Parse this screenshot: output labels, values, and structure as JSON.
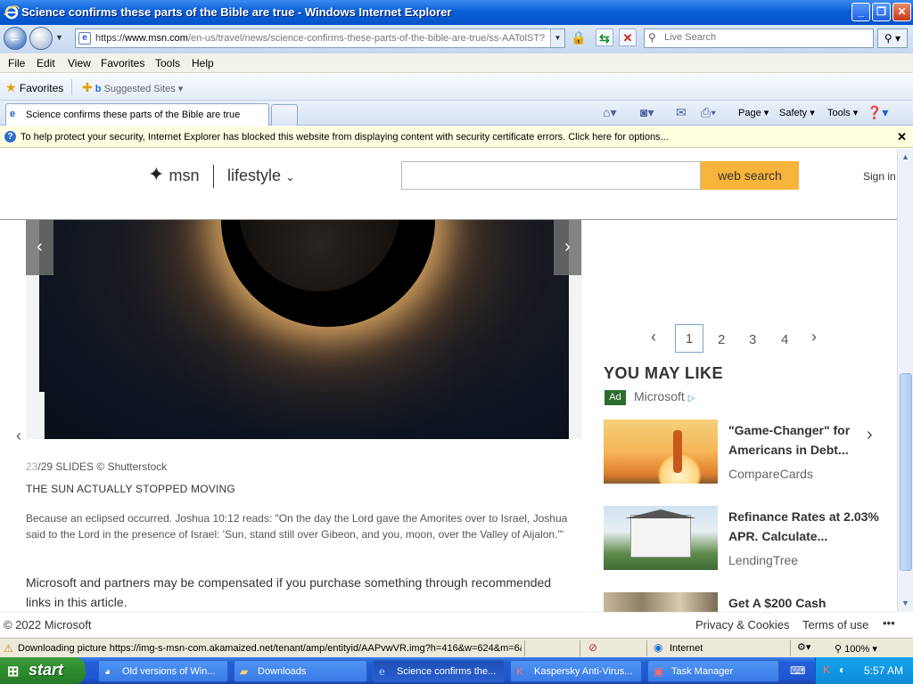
{
  "window": {
    "title": "Science confirms these parts of the Bible are true - Windows Internet Explorer",
    "min": "_",
    "max": "❐",
    "close": "✕"
  },
  "addressbar": {
    "url_scheme": "https://",
    "url_host": "www.msn.com",
    "url_path": "/en-us/travel/news/science-confirms-these-parts-of-the-bible-are-true/ss-AATolST?",
    "search_placeholder": "Live Search"
  },
  "menu": [
    "File",
    "Edit",
    "View",
    "Favorites",
    "Tools",
    "Help"
  ],
  "favorites": {
    "label": "Favorites",
    "suggested": "Suggested Sites"
  },
  "tab": {
    "label": "Science confirms these parts of the Bible are true"
  },
  "commandbar": {
    "page": "Page",
    "safety": "Safety",
    "tools": "Tools"
  },
  "infobar": {
    "message": "To help protect your security, Internet Explorer has blocked this website from displaying content with security certificate errors. Click here for options..."
  },
  "msn": {
    "logo": "msn",
    "section": "lifestyle",
    "search_button": "web search",
    "signin": "Sign in"
  },
  "slide": {
    "current": "23",
    "count_rest": "/29 SLIDES © Shutterstock",
    "heading": "THE SUN ACTUALLY STOPPED MOVING",
    "body": "Because an eclipsed occurred. Joshua 10:12 reads: \"On the day the Lord gave the Amorites over to Israel, Joshua said to the Lord in the presence of Israel: 'Sun, stand still over Gibeon, and you, moon, over the Valley of Aijalon.'\"",
    "disclaimer": "Microsoft and partners may be compensated if you purchase something through recommended links in this article."
  },
  "pager": {
    "pages": [
      "1",
      "2",
      "3",
      "4"
    ],
    "current": "1"
  },
  "recommend": {
    "heading": "YOU MAY LIKE",
    "ad_tag": "Ad",
    "ad_source": "Microsoft",
    "cards": [
      {
        "title": "\"Game-Changer\" for Americans in Debt...",
        "source": "CompareCards"
      },
      {
        "title": "Refinance Rates at 2.03% APR. Calculate...",
        "source": "LendingTree"
      },
      {
        "title": "Get A $200 Cash",
        "source": ""
      }
    ]
  },
  "footer": {
    "copyright": "© 2022 Microsoft",
    "privacy": "Privacy & Cookies",
    "terms": "Terms of use",
    "more": "•••"
  },
  "statusbar": {
    "download": "Downloading picture https://img-s-msn-com.akamaized.net/tenant/amp/entityid/AAPvwVR.img?h=416&w=624&m=6&",
    "zone": "Internet",
    "zoom": "100%"
  },
  "taskbar": {
    "start": "start",
    "tasks": [
      {
        "label": "Old versions of Win...",
        "icon": "raccoon-icon"
      },
      {
        "label": "Downloads",
        "icon": "folder-icon"
      },
      {
        "label": "Science confirms the...",
        "icon": "ie-icon"
      },
      {
        "label": "Kaspersky Anti-Virus...",
        "icon": "kaspersky-icon"
      },
      {
        "label": "Task Manager",
        "icon": "taskmanager-icon"
      }
    ],
    "clock": "5:57 AM"
  },
  "colors": {
    "accent_button": "#f7b43a",
    "ad_tag": "#2b6c2f",
    "titlebar": "#0a5fd8",
    "start": "#2f8f2f"
  }
}
